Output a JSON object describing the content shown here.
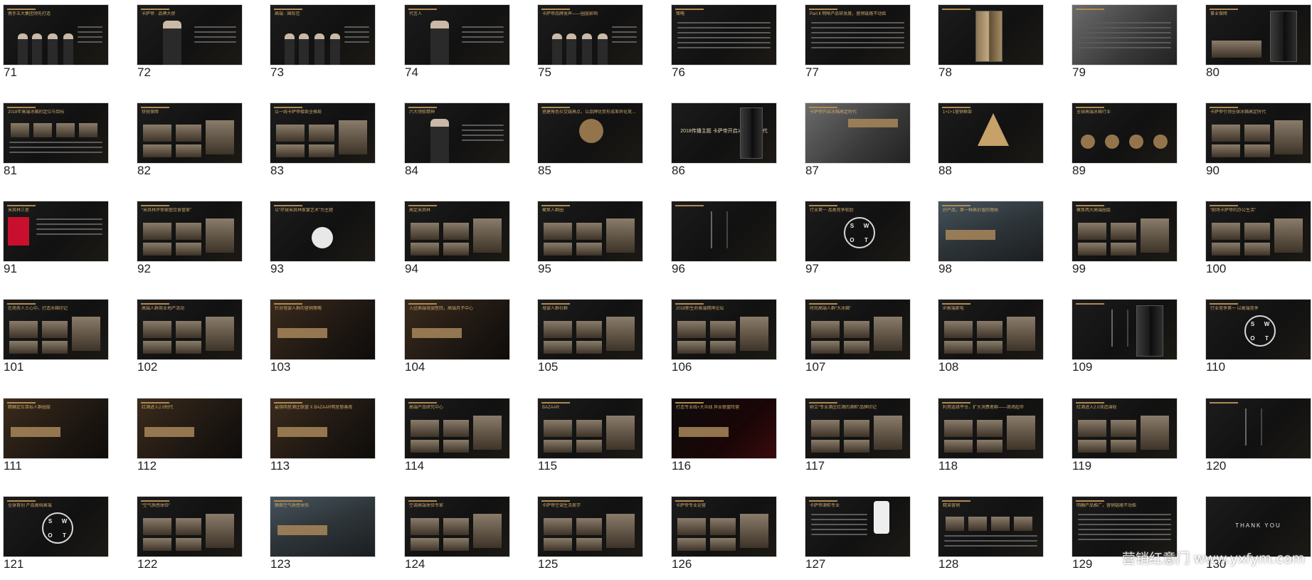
{
  "slides": [
    {
      "n": "71",
      "style": "people",
      "caption": "携手五大集团领先打造"
    },
    {
      "n": "72",
      "style": "person-one",
      "caption": "卡萨帝 · 品牌大使"
    },
    {
      "n": "73",
      "style": "people",
      "caption": "高端 · 国际范"
    },
    {
      "n": "74",
      "style": "person-one",
      "caption": "代言人"
    },
    {
      "n": "75",
      "style": "people",
      "caption": "卡萨帝品牌发声——圈层影响"
    },
    {
      "n": "76",
      "style": "text",
      "caption": "策略"
    },
    {
      "n": "77",
      "style": "text",
      "caption": "Part Ⅱ  明晰产品研发度，营销链路不动摇"
    },
    {
      "n": "78",
      "style": "fridge-gold",
      "caption": ""
    },
    {
      "n": "79",
      "style": "grey-text",
      "caption": ""
    },
    {
      "n": "80",
      "style": "fridge-photo",
      "caption": "事业保障"
    },
    {
      "n": "81",
      "style": "icons",
      "caption": "2018年高端冰箱的定位与目标"
    },
    {
      "n": "82",
      "style": "photos",
      "caption": "铁锐保障"
    },
    {
      "n": "83",
      "style": "photos",
      "caption": "以一线卡萨帝极致全格局"
    },
    {
      "n": "84",
      "style": "person-one",
      "caption": "六大领航精神"
    },
    {
      "n": "85",
      "style": "circle",
      "caption": "搭建角色社交链高点，以品牌优势形成差异化竞争力"
    },
    {
      "n": "86",
      "style": "center",
      "caption": "2018传播主题  卡萨帝开启冰箱高定时代"
    },
    {
      "n": "87",
      "style": "grey",
      "caption": "卡萨帝开启冰箱高定时代"
    },
    {
      "n": "88",
      "style": "triangle",
      "caption": "1+1+1营销框架"
    },
    {
      "n": "89",
      "style": "globe",
      "caption": "全球高端冰箱行业"
    },
    {
      "n": "90",
      "style": "photos",
      "caption": "卡萨帝引领全球冰箱高定时代"
    },
    {
      "n": "91",
      "style": "redlogo",
      "caption": "米其林三星"
    },
    {
      "n": "92",
      "style": "photos",
      "caption": "“米其林评审家庭饮食管家”"
    },
    {
      "n": "93",
      "style": "badge",
      "caption": "以“环球米其林家宴艺术”为主题"
    },
    {
      "n": "94",
      "style": "photos",
      "caption": "高定米其林"
    },
    {
      "n": "95",
      "style": "photos",
      "caption": "聚焦人群圈"
    },
    {
      "n": "96",
      "style": "digit",
      "caption": ""
    },
    {
      "n": "97",
      "style": "swot",
      "caption": "行业第一  品类竞争软肋"
    },
    {
      "n": "98",
      "style": "photo",
      "caption": "好产品，第一种高价值的理由"
    },
    {
      "n": "99",
      "style": "photos",
      "caption": "聚焦两大高端圈层"
    },
    {
      "n": "100",
      "style": "photos",
      "caption": "“剧场卡萨帝的办公生活”"
    },
    {
      "n": "101",
      "style": "photos",
      "caption": "在商务人士心中，打造冰箱印记"
    },
    {
      "n": "102",
      "style": "photos",
      "caption": "高端人群商业地产活动"
    },
    {
      "n": "103",
      "style": "photo-warm",
      "caption": "针对母婴人群的营销策略"
    },
    {
      "n": "104",
      "style": "photo-warm",
      "caption": "入驻高端母婴医院，高端月子中心"
    },
    {
      "n": "105",
      "style": "photos",
      "caption": "母婴人群社群"
    },
    {
      "n": "106",
      "style": "photos",
      "caption": "2018新生命高端精神论坛"
    },
    {
      "n": "107",
      "style": "photos",
      "caption": "时尚高端人群“大冰箱”"
    },
    {
      "n": "108",
      "style": "photos",
      "caption": "IP高端家电"
    },
    {
      "n": "109",
      "style": "digit",
      "caption": ""
    },
    {
      "n": "110",
      "style": "swot",
      "caption": "行业竞争第一  以高端竞争"
    },
    {
      "n": "111",
      "style": "photo-warm",
      "caption": "精确定位目标人群圈层"
    },
    {
      "n": "112",
      "style": "photo-warm",
      "caption": "红酒进入2.0时代"
    },
    {
      "n": "113",
      "style": "photo-warm",
      "caption": "最强明星酒庄联盟 X BAZAAR明星慈善夜"
    },
    {
      "n": "114",
      "style": "photos",
      "caption": "高端产品研究中心"
    },
    {
      "n": "115",
      "style": "photos",
      "caption": "BAZAAR"
    },
    {
      "n": "116",
      "style": "red",
      "caption": "打造专业线+大众线  异业联盟阵营"
    },
    {
      "n": "117",
      "style": "photos",
      "caption": "树立“专业酒庄红酒的酒柜”品牌印记"
    },
    {
      "n": "118",
      "style": "photos",
      "caption": "利用选择平台，扩大消费者群——商场超市"
    },
    {
      "n": "119",
      "style": "photos",
      "caption": "红酒进入2.0深造课程"
    },
    {
      "n": "120",
      "style": "digit",
      "caption": ""
    },
    {
      "n": "121",
      "style": "swot",
      "caption": "全球首创  产品高档高端"
    },
    {
      "n": "122",
      "style": "photos",
      "caption": "“空气质感体验”"
    },
    {
      "n": "123",
      "style": "photo",
      "caption": "静面空气质感体验"
    },
    {
      "n": "124",
      "style": "photos",
      "caption": "空调高端体验专家"
    },
    {
      "n": "125",
      "style": "photos",
      "caption": "卡萨帝空调生活美学"
    },
    {
      "n": "126",
      "style": "photos",
      "caption": "卡萨帝专业运营"
    },
    {
      "n": "127",
      "style": "phone",
      "caption": "卡萨帝酒柜专业"
    },
    {
      "n": "128",
      "style": "icons",
      "caption": "精准营销"
    },
    {
      "n": "129",
      "style": "text",
      "caption": "明确产品推广，营销链路不动摇"
    },
    {
      "n": "130",
      "style": "thanks",
      "caption": "THANK YOU"
    }
  ],
  "watermark": "营销红意门 www.yxfym.com"
}
